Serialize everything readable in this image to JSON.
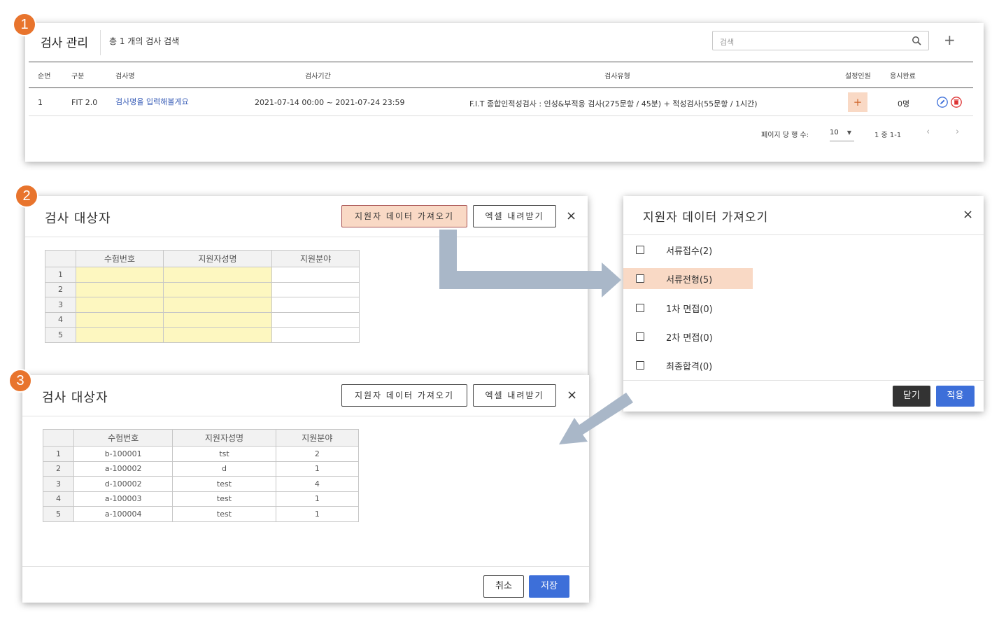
{
  "badges": [
    "1",
    "2",
    "3"
  ],
  "exam_list": {
    "title": "검사 관리",
    "count_text": "총 1 개의 검사 검색",
    "search_placeholder": "검색",
    "add_label": "+",
    "columns": [
      "순번",
      "구분",
      "검사명",
      "검사기간",
      "검사유형",
      "설정인원",
      "응시완료"
    ],
    "rows": [
      {
        "no": "1",
        "category": "FIT 2.0",
        "name": "검사명을 입력해볼게요",
        "period": "2021-07-14 00:00 ~ 2021-07-24 23:59",
        "type": "F.I.T 종합인적성검사 : 인성&부적응 검사(275문항 / 45분) + 적성검사(55문항 / 1시간)",
        "set_count": "+",
        "completed": "0명"
      }
    ],
    "pagination": {
      "per_page_label": "페이지 당 행 수:",
      "per_page_value": "10",
      "range": "1 중 1-1",
      "prev": "‹",
      "next": "›"
    }
  },
  "target_dialog_empty": {
    "title": "검사 대상자",
    "import_button": "지원자 데이터 가져오기",
    "excel_button": "엑셀 내려받기",
    "close": "×",
    "columns": [
      "수험번호",
      "지원자성명",
      "지원분야"
    ],
    "rows": [
      "1",
      "2",
      "3",
      "4",
      "5"
    ]
  },
  "import_dialog": {
    "title": "지원자 데이터 가져오기",
    "close": "×",
    "options": [
      "서류접수(2)",
      "서류전형(5)",
      "1차 면접(0)",
      "2차 면접(0)",
      "최종합격(0)"
    ],
    "highlighted_index": 1,
    "close_button": "닫기",
    "apply_button": "적용"
  },
  "target_dialog_filled": {
    "title": "검사 대상자",
    "import_button": "지원자 데이터 가져오기",
    "excel_button": "엑셀 내려받기",
    "close": "×",
    "columns": [
      "수험번호",
      "지원자성명",
      "지원분야"
    ],
    "rows": [
      {
        "n": "1",
        "id": "b-100001",
        "name": "tst",
        "field": "2"
      },
      {
        "n": "2",
        "id": "a-100002",
        "name": "d",
        "field": "1"
      },
      {
        "n": "3",
        "id": "d-100002",
        "name": "test",
        "field": "4"
      },
      {
        "n": "4",
        "id": "a-100003",
        "name": "test",
        "field": "1"
      },
      {
        "n": "5",
        "id": "a-100004",
        "name": "test",
        "field": "1"
      }
    ],
    "cancel_button": "취소",
    "save_button": "저장"
  },
  "colors": {
    "badge": "#e8742d",
    "highlight": "#f9d9c5",
    "primary": "#3d6fd9",
    "link": "#3b5fb8",
    "arrow": "#a9b7c8",
    "yellow_cell": "#fdf7c0"
  }
}
